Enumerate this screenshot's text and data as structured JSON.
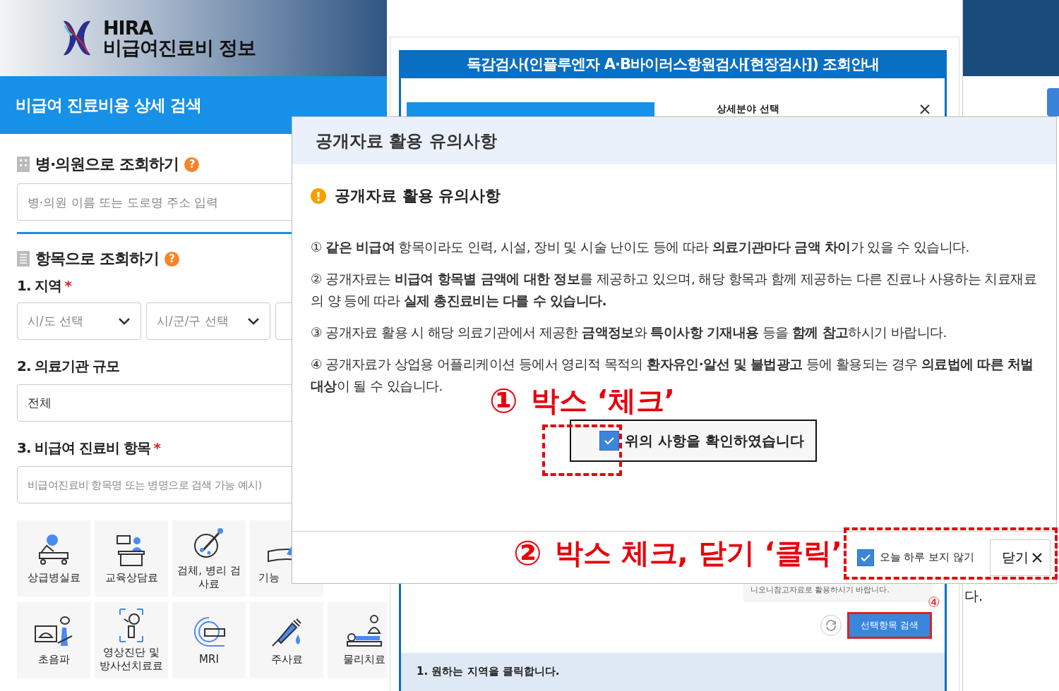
{
  "header": {
    "logo_title": "HIRA",
    "logo_subtitle": "비급여진료비 정보"
  },
  "search_bar": {
    "title": "비급여 진료비용 상세 검색"
  },
  "hospital_search": {
    "title": "병·의원으로 조회하기",
    "help": "?",
    "placeholder": "병·의원 이름 또는 도로명 주소 입력"
  },
  "item_search": {
    "title": "항목으로 조회하기",
    "help": "?",
    "region": {
      "label": "1. 지역",
      "required_mark": "*",
      "selects": [
        "시/도 선택",
        "시/군/구 선택"
      ]
    },
    "scale": {
      "label": "2. 의료기관 규모",
      "value": "전체"
    },
    "item": {
      "label": "3. 비급여 진료비 항목",
      "required_mark": "*",
      "placeholder": "비급여진료비 항목명 또는 병명으로 검색 가능 예시)"
    }
  },
  "categories": [
    {
      "label": "상급병실료",
      "kind": "bed"
    },
    {
      "label": "교육상담료",
      "kind": "counsel"
    },
    {
      "label": "검체, 병리 검사료",
      "kind": "specimen"
    },
    {
      "label": "기능",
      "kind": "function"
    },
    {
      "label": "초음파",
      "kind": "ultrasound"
    },
    {
      "label": "영상진단 및 방사선치료료",
      "kind": "xray"
    },
    {
      "label": "MRI",
      "kind": "mri"
    },
    {
      "label": "주사료",
      "kind": "injection"
    },
    {
      "label": "물리치료",
      "kind": "physio"
    }
  ],
  "guide": {
    "title": "독감검사(인플루엔자 A·B바이러스항원검사[현장검사]) 조회안내",
    "panel_title": "상세분야 선택",
    "note": "니오니참고자료로 활용하시기 바랍니다.",
    "search_button": "선택항목 검색",
    "step_marker": "④",
    "step_text": "1. 원하는 지역을 클릭합니다."
  },
  "right_panel": {
    "text": "다."
  },
  "modal": {
    "title": "공개자료 활용 유의사항",
    "heading": "공개자료 활용 유의사항",
    "notices": [
      "① **같은 비급여** 항목이라도 인력, 시설, 장비 및 시술 난이도 등에 따라 **의료기관마다 금액 차이**가 있을 수 있습니다.",
      "② 공개자료는 **비급여 항목별 금액에 대한 정보**를 제공하고 있으며, 해당 항목과 함께 제공하는 다른 진료나 사용하는 치료재료의 양 등에 따라 **실제 총진료비는 다를 수 있습니다.**",
      "③ 공개자료 활용 시 해당 의료기관에서 제공한 **금액정보**와 **특이사항 기재내용** 등을 **함께 참고**하시기 바랍니다.",
      "④ 공개자료가 상업용 어플리케이션 등에서 영리적 목적의 **환자유인·알선 및 불법광고** 등에 활용되는 경우 **의료법에 따른 처벌 대상**이 될 수 있습니다."
    ],
    "confirm": {
      "label": "위의 사항을 확인하였습니다",
      "checked": true
    },
    "dont_show": {
      "label": "오늘 하루 보지 않기",
      "checked": true
    },
    "close": "닫기"
  },
  "annotations": [
    {
      "marker": "①",
      "text": "박스 ‘체크’"
    },
    {
      "marker": "②",
      "text": "박스 체크, 닫기 ‘클릭’"
    }
  ]
}
